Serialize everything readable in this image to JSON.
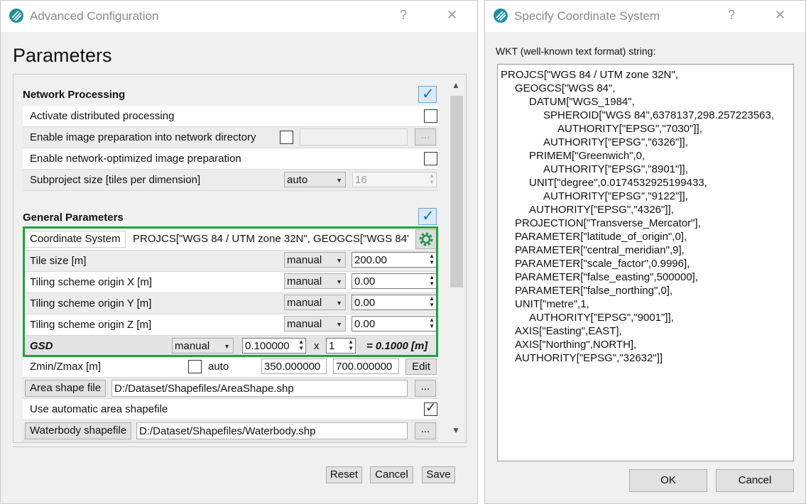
{
  "adv": {
    "title": "Advanced Configuration",
    "help": "?",
    "close": "✕",
    "heading": "Parameters",
    "network": {
      "title": "Network Processing",
      "distributed_label": "Activate distributed processing",
      "image_prep_label": "Enable image preparation into network directory",
      "image_prep_browse": "...",
      "net_opt_label": "Enable network-optimized image preparation",
      "subproject_label": "Subproject size [tiles per dimension]",
      "subproject_mode": "auto",
      "subproject_value": "16"
    },
    "general": {
      "title": "General Parameters",
      "coord_label": "Coordinate System",
      "coord_value": "PROJCS[\"WGS 84 / UTM zone 32N\", GEOGCS[\"WGS 84\"",
      "tile_size_label": "Tile size [m]",
      "tile_size_mode": "manual",
      "tile_size_value": "200.00",
      "origin_x_label": "Tiling scheme origin X [m]",
      "origin_x_mode": "manual",
      "origin_x_value": "0.00",
      "origin_y_label": "Tiling scheme origin Y [m]",
      "origin_y_mode": "manual",
      "origin_y_value": "0.00",
      "origin_z_label": "Tiling scheme origin Z [m]",
      "origin_z_mode": "manual",
      "origin_z_value": "0.00",
      "gsd_label": "GSD",
      "gsd_mode": "manual",
      "gsd_value": "0.100000",
      "gsd_x": "x",
      "gsd_factor": "1",
      "gsd_result": "= 0.1000 [m]",
      "zminmax_label": "Zmin/Zmax [m]",
      "zminmax_auto": "auto",
      "zmin": "350.000000",
      "zmax": "700.000000",
      "zminmax_edit": "Edit",
      "area_shape_label": "Area shape file",
      "area_shape_path": "D:/Dataset/Shapefiles/AreaShape.shp",
      "area_shape_browse": "...",
      "auto_area_label": "Use automatic area shapefile",
      "waterbody_label": "Waterbody shapefile",
      "waterbody_path": "D:/Dataset/Shapefiles/Waterbody.shp",
      "waterbody_browse": "..."
    },
    "buttons": {
      "reset": "Reset",
      "cancel": "Cancel",
      "save": "Save"
    }
  },
  "scs": {
    "title": "Specify Coordinate System",
    "help": "?",
    "close": "✕",
    "label": "WKT (well-known text format) string:",
    "wkt_lines": [
      "PROJCS[\"WGS 84 / UTM zone 32N\",",
      "GEOGCS[\"WGS 84\",",
      "DATUM[\"WGS_1984\",",
      "SPHEROID[\"WGS 84\",6378137,298.257223563,",
      "AUTHORITY[\"EPSG\",\"7030\"]],",
      "AUTHORITY[\"EPSG\",\"6326\"]],",
      "PRIMEM[\"Greenwich\",0,",
      "AUTHORITY[\"EPSG\",\"8901\"]],",
      "UNIT[\"degree\",0.0174532925199433,",
      "AUTHORITY[\"EPSG\",\"9122\"]],",
      "AUTHORITY[\"EPSG\",\"4326\"]],",
      "PROJECTION[\"Transverse_Mercator\"],",
      "PARAMETER[\"latitude_of_origin\",0],",
      "PARAMETER[\"central_meridian\",9],",
      "PARAMETER[\"scale_factor\",0.9996],",
      "PARAMETER[\"false_easting\",500000],",
      "PARAMETER[\"false_northing\",0],",
      "UNIT[\"metre\",1,",
      "AUTHORITY[\"EPSG\",\"9001\"]],",
      "AXIS[\"Easting\",EAST],",
      "AXIS[\"Northing\",NORTH],",
      "AUTHORITY[\"EPSG\",\"32632\"]]"
    ],
    "ok": "OK",
    "cancel": "Cancel"
  },
  "colors": {
    "highlight_border": "#1fa33b",
    "check_accent": "#1a73b8"
  },
  "icons": {
    "app": "app-logo-icon",
    "settings": "gear-icon",
    "checkmark": "checkmark-icon"
  }
}
